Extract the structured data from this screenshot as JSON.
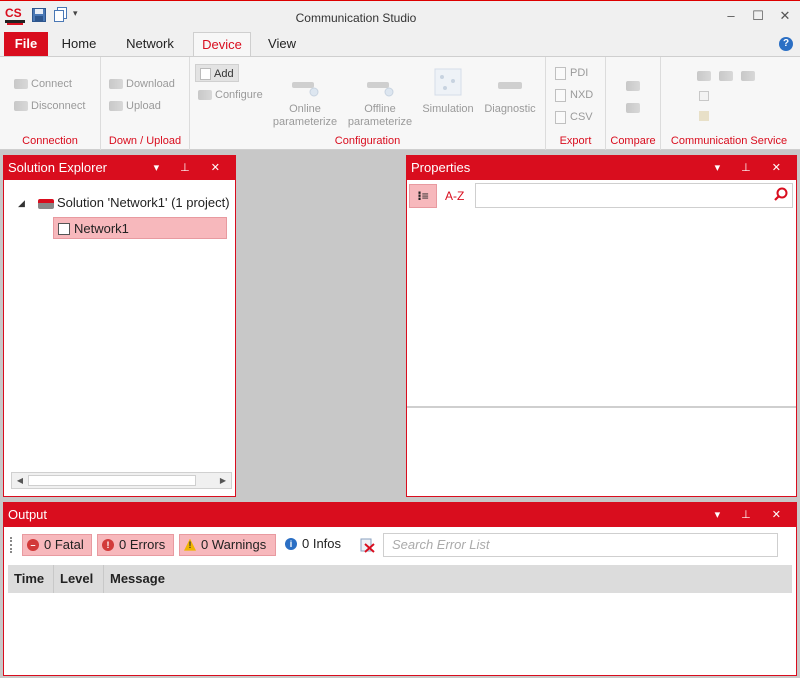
{
  "window": {
    "title": "Communication Studio",
    "controls": {
      "minimize": "–",
      "maximize": "☐",
      "close": "✕"
    }
  },
  "app_logo_text": "CS",
  "quick_access": {
    "menu_glyph": "▾"
  },
  "menu": {
    "tabs": [
      "File",
      "Home",
      "Network",
      "Device",
      "View"
    ],
    "active": "Device",
    "help": "?"
  },
  "ribbon": {
    "groups": {
      "connection": {
        "label": "Connection",
        "items": [
          "Connect",
          "Disconnect"
        ]
      },
      "download_upload": {
        "label": "Down / Upload",
        "items": [
          "Download",
          "Upload"
        ]
      },
      "configuration": {
        "label": "Configuration",
        "add": "Add",
        "configure": "Configure",
        "online_1": "Online",
        "online_2": "parameterize",
        "offline_1": "Offline",
        "offline_2": "parameterize",
        "simulation": "Simulation",
        "diagnostic": "Diagnostic"
      },
      "export": {
        "label": "Export",
        "items": [
          "PDI",
          "NXD",
          "CSV"
        ]
      },
      "compare": {
        "label": "Compare"
      },
      "communication_service": {
        "label": "Communication Service"
      }
    }
  },
  "solution_explorer": {
    "title": "Solution Explorer",
    "header_buttons": "▾ ⊥ ✕",
    "tree": {
      "expander": "◢",
      "solution": "Solution 'Network1' (1 project)",
      "network": "Network1"
    },
    "scroll_left": "◀",
    "scroll_right": "▶"
  },
  "properties": {
    "title": "Properties",
    "header_buttons": "▾ ⊥ ✕",
    "categorized_glyph": "⁝≡",
    "az_label": "A-Z",
    "search_icon": "⚲"
  },
  "output": {
    "title": "Output",
    "header_buttons": "▾ ⊥ ✕",
    "fatal": "0 Fatal",
    "errors": "0 Errors",
    "warnings": "0 Warnings",
    "infos": "0 Infos",
    "search_placeholder": "Search Error List",
    "columns": [
      "Time",
      "Level",
      "Message"
    ]
  },
  "colors": {
    "accent": "#d90d1e",
    "selection": "#f7b8bc"
  }
}
